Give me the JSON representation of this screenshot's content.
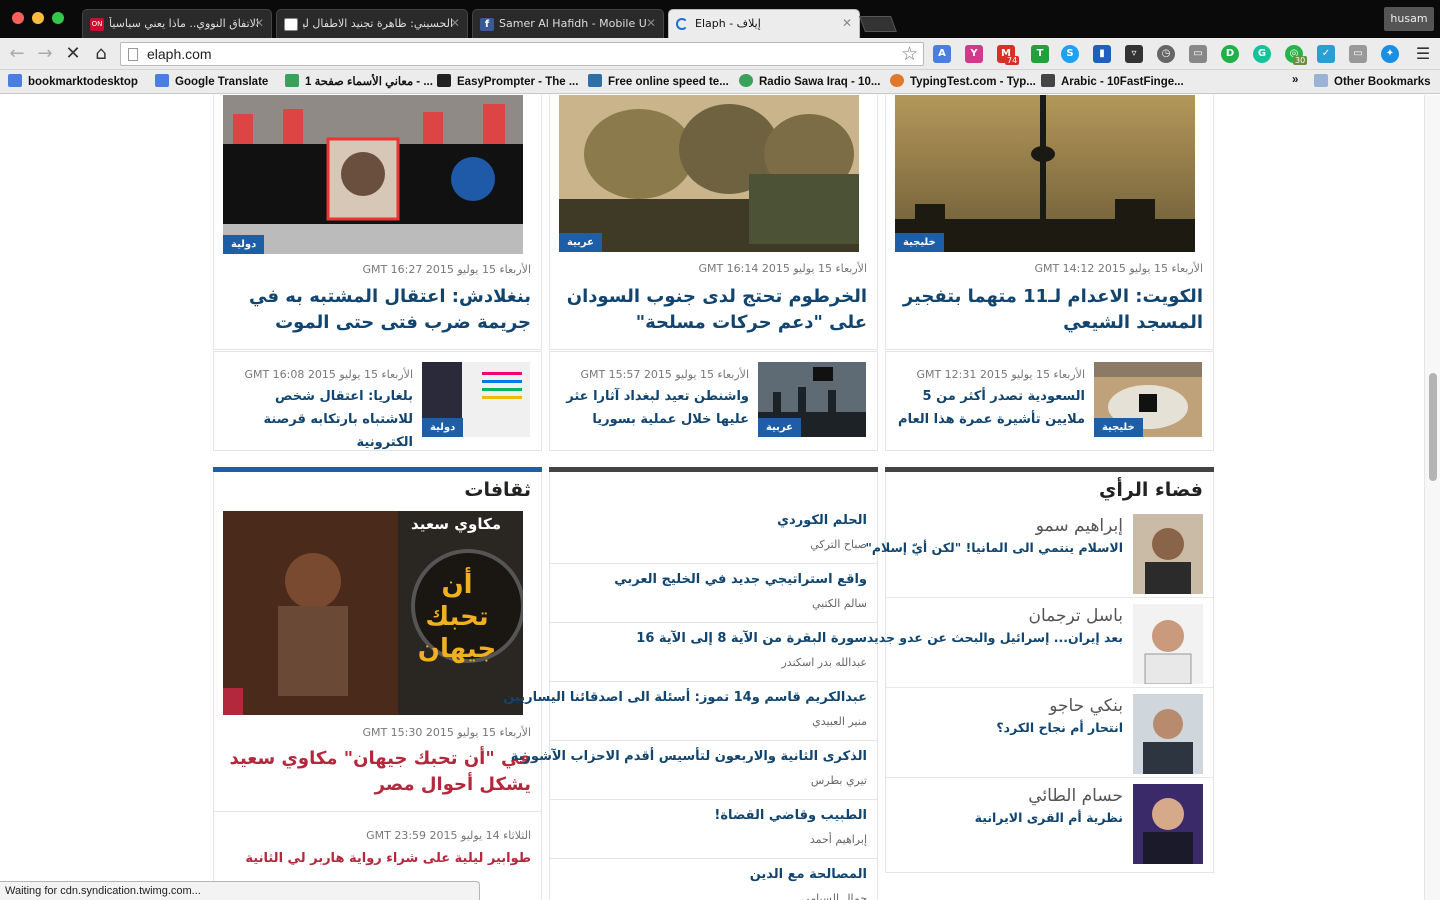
{
  "browser": {
    "tabs": [
      {
        "title": "الاتفاق النووي.. ماذا يعني سياسياً ",
        "favicon": "ON"
      },
      {
        "title": "الحسيني: ظاهرة تجنيد الاطفال ليس",
        "favicon": ""
      },
      {
        "title": "Samer Al Hafidh - Mobile U",
        "favicon": "f"
      },
      {
        "title": "Elaph - إيلاف",
        "favicon": ""
      }
    ],
    "profile_name": "husam",
    "url": "elaph.com",
    "extension_badges": {
      "gmail": "74",
      "grammarly": "30"
    },
    "bookmarks": [
      "bookmarktodesktop",
      "Google Translate",
      "معاني الأسماء صفحة 1 - ...",
      "EasyPrompter - The ...",
      "Free online speed te...",
      "Radio Sawa Iraq - 10...",
      "TypingTest.com - Typ...",
      "Arabic - 10FastFinge..."
    ],
    "bookmarks_overflow": "»",
    "other_bookmarks": "Other Bookmarks",
    "status": "Waiting for cdn.syndication.twimg.com..."
  },
  "colors": {
    "accent_blue": "#1d5ea6",
    "headline_blue": "#11456f",
    "culture_red": "#b3283c",
    "section_dark": "#444444"
  },
  "top_stories": [
    {
      "category": "دولية",
      "date": "الأربعاء 15 يوليو 2015 GMT 16:27",
      "title": "بنغلادش: اعتقال المشتبه به في جريمة ضرب فتى حتى الموت"
    },
    {
      "category": "عربية",
      "date": "الأربعاء 15 يوليو 2015 GMT 16:14",
      "title": "الخرطوم تحتج لدى جنوب السودان على \"دعم حركات مسلحة\""
    },
    {
      "category": "خليجية",
      "date": "الأربعاء 15 يوليو 2015 GMT 14:12",
      "title": "الكويت: الاعدام لـ11 متهما بتفجير المسجد الشيعي"
    }
  ],
  "sub_stories": [
    {
      "category": "دولية",
      "date": "الأربعاء 15 يوليو 2015 GMT 16:08",
      "title": "بلغاريا: اعتقال شخص للاشتباه بارتكابه قرصنة الكترونية"
    },
    {
      "category": "عربية",
      "date": "الأربعاء 15 يوليو 2015 GMT 15:57",
      "title": "واشنطن تعيد لبغداد آثارا عثر عليها خلال عملية بسوريا"
    },
    {
      "category": "خليجية",
      "date": "الأربعاء 15 يوليو 2015 GMT 12:31",
      "title": "السعودية تصدر أكثر من 5 ملايين تأشيرة عمرة هذا العام"
    }
  ],
  "culture": {
    "section_title": "ثقافات",
    "image_text_author": "مكاوي سعيد",
    "image_text_title": "أن تحبك جيهان",
    "date": "الأربعاء 15 يوليو 2015 GMT 15:30",
    "title": "في \"أن تحبك جيهان\" مكاوي سعيد يشكل أحوال مصر",
    "second_date": "الثلاثاء 14 يوليو 2015 GMT 23:59",
    "second_title": "طوابير ليلية على شراء رواية هاربر لي الثانية"
  },
  "articles_list": [
    {
      "title": "الحلم الكوردي",
      "author": "صباح التركي"
    },
    {
      "title": "واقع استراتيجي جديد في الخليج العربي",
      "author": "سالم الكتبي"
    },
    {
      "title": "سورة البقرة من الآية 8 إلى الآية 16",
      "author": "عبدالله بدر اسكندر"
    },
    {
      "title": "عبدالكريم قاسم و14 تموز: أسئلة الى اصدقائنا اليساريين",
      "author": "منير العبيدي"
    },
    {
      "title": "الذكرى الثانية والاربعون لتأسيس أقدم الاحزاب الآشورية",
      "author": "تيري بطرس"
    },
    {
      "title": "الطبيب وقاضي القضاة!",
      "author": "إبراهيم أحمد"
    },
    {
      "title": "المصالحة مع الدين",
      "author": "جمال السيامي"
    }
  ],
  "opinion": {
    "section_title": "فضاء الرأي",
    "items": [
      {
        "author": "إبراهيم سمو",
        "title": "الاسلام ينتمي الى المانيا! \"لكن أيّ إسلام\""
      },
      {
        "author": "باسل ترجمان",
        "title": "بعد إيران... إسرائيل والبحث عن عدو جديد"
      },
      {
        "author": "بنكي حاجو",
        "title": "انتحار أم نجاح الكرد؟"
      },
      {
        "author": "حسام الطائي",
        "title": "نظرية أم القرى الايرانية"
      }
    ]
  }
}
